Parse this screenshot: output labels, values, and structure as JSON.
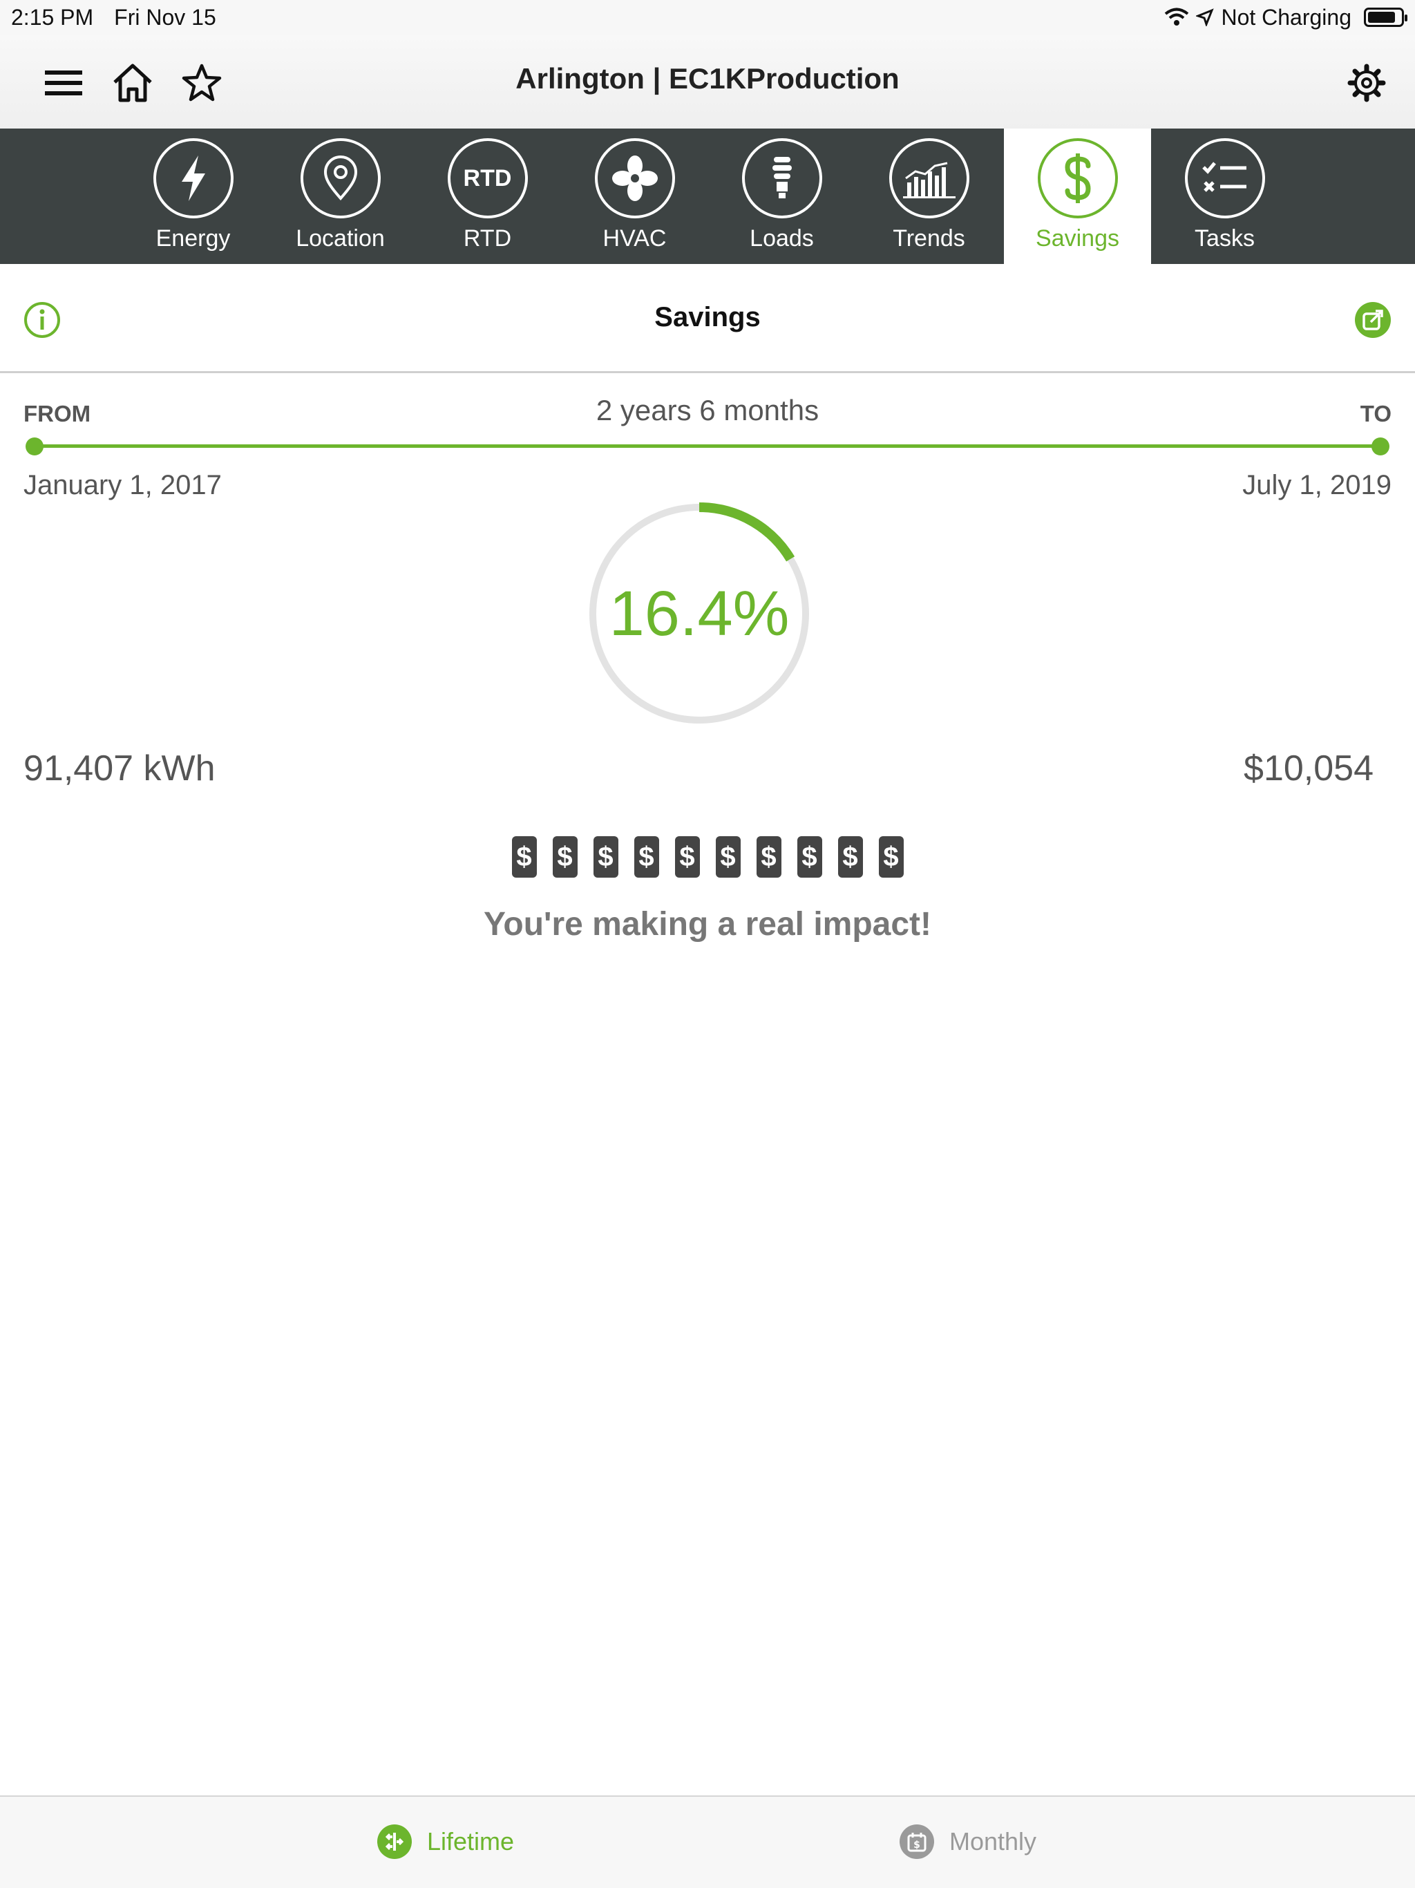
{
  "status_bar": {
    "time": "2:15 PM",
    "date": "Fri Nov 15",
    "charging": "Not Charging",
    "battery_level": 0.85
  },
  "header": {
    "title": "Arlington | EC1KProduction",
    "icons": [
      "menu-icon",
      "home-icon",
      "star-icon",
      "gear-icon"
    ]
  },
  "tabs": [
    {
      "label": "Energy",
      "icon": "bolt-icon",
      "active": false
    },
    {
      "label": "Location",
      "icon": "location-pin-icon",
      "active": false
    },
    {
      "label": "RTD",
      "icon": "rtd-icon",
      "active": false
    },
    {
      "label": "HVAC",
      "icon": "fan-icon",
      "active": false
    },
    {
      "label": "Loads",
      "icon": "bulb-icon",
      "active": false
    },
    {
      "label": "Trends",
      "icon": "trends-icon",
      "active": false
    },
    {
      "label": "Savings",
      "icon": "dollar-icon",
      "active": true
    },
    {
      "label": "Tasks",
      "icon": "checklist-icon",
      "active": false
    }
  ],
  "rtd_text": "RTD",
  "section": {
    "title": "Savings"
  },
  "range": {
    "from_label": "FROM",
    "to_label": "TO",
    "duration": "2 years 6 months",
    "from_date": "January 1, 2017",
    "to_date": "July 1, 2019"
  },
  "savings": {
    "percent_text": "16.4%",
    "percent_value": 16.4,
    "kwh": "91,407 kWh",
    "cost": "$10,054",
    "dollar_symbol": "$",
    "dollar_count": 10,
    "message": "You're making a real impact!"
  },
  "bottom_tabs": {
    "lifetime": "Lifetime",
    "monthly": "Monthly"
  },
  "colors": {
    "accent": "#6cb52d",
    "tab_bar": "#3d4343",
    "text_muted": "#555555"
  }
}
